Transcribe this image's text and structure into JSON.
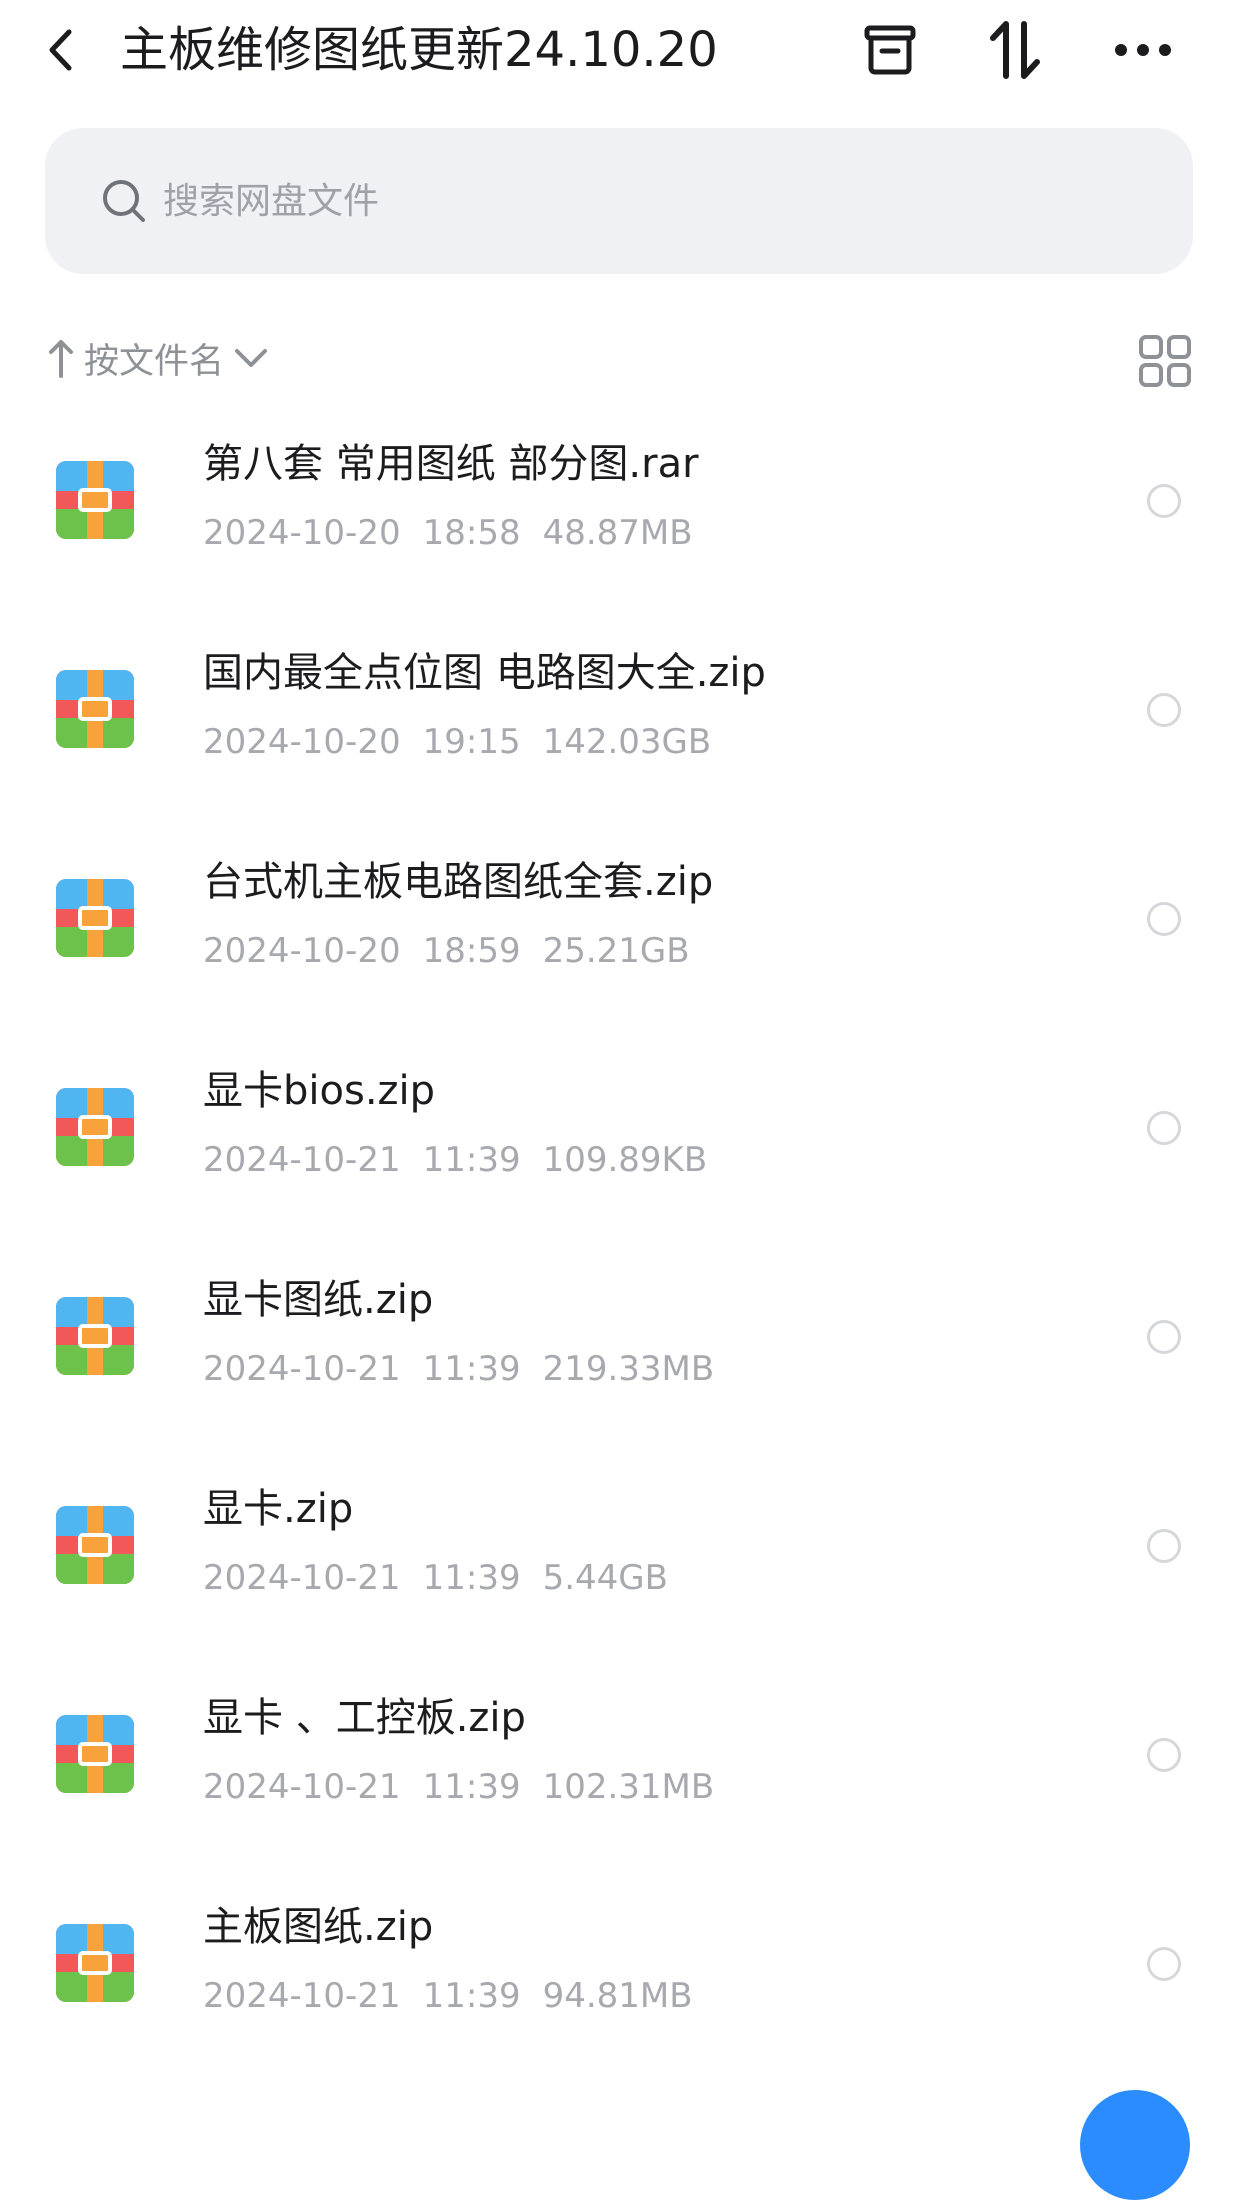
{
  "header": {
    "title": "主板维修图纸更新24.10.20",
    "back_icon": "chevron-left-icon",
    "actions": [
      "archive-box-icon",
      "transfer-arrows-icon",
      "more-horizontal-icon"
    ]
  },
  "search": {
    "placeholder": "搜索网盘文件",
    "value": ""
  },
  "sort": {
    "label": "按文件名",
    "direction": "ascending"
  },
  "view_toggle": "grid-view-icon",
  "files": [
    {
      "name": "第八套 常用图纸 部分图.rar",
      "date": "2024-10-20",
      "time": "18:58",
      "size": "48.87MB"
    },
    {
      "name": "国内最全点位图 电路图大全.zip",
      "date": "2024-10-20",
      "time": "19:15",
      "size": "142.03GB"
    },
    {
      "name": "台式机主板电路图纸全套.zip",
      "date": "2024-10-20",
      "time": "18:59",
      "size": "25.21GB"
    },
    {
      "name": "显卡bios.zip",
      "date": "2024-10-21",
      "time": "11:39",
      "size": "109.89KB"
    },
    {
      "name": "显卡图纸.zip",
      "date": "2024-10-21",
      "time": "11:39",
      "size": "219.33MB"
    },
    {
      "name": "显卡.zip",
      "date": "2024-10-21",
      "time": "11:39",
      "size": "5.44GB"
    },
    {
      "name": "显卡 、工控板.zip",
      "date": "2024-10-21",
      "time": "11:39",
      "size": "102.31MB"
    },
    {
      "name": "主板图纸.zip",
      "date": "2024-10-21",
      "time": "11:39",
      "size": "94.81MB"
    }
  ],
  "colors": {
    "accent": "#2b8cff",
    "archive_red": "#f2585a",
    "archive_orange": "#f7a23a",
    "archive_blue": "#4fb6f2",
    "archive_green": "#6cc24a"
  }
}
